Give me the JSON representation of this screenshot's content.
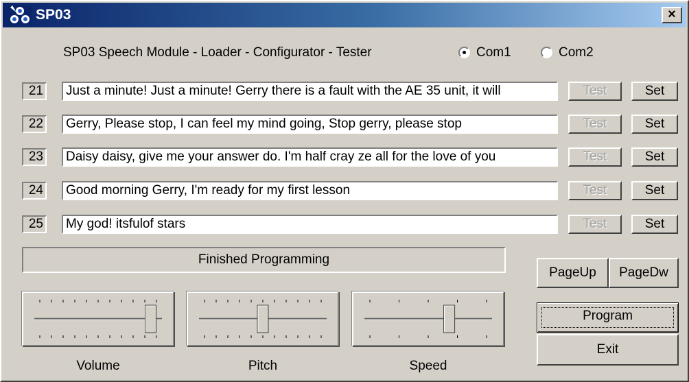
{
  "window": {
    "title": "SP03",
    "close_glyph": "×",
    "app_icon": "sp03-app-icon"
  },
  "header": {
    "subtitle": "SP03 Speech Module - Loader - Configurator - Tester",
    "ports": [
      {
        "label": "Com1",
        "selected": true
      },
      {
        "label": "Com2",
        "selected": false
      }
    ]
  },
  "phrases": [
    {
      "number": "21",
      "text": "Just a minute! Just a minute! Gerry there is a fault with the AE 35 unit, it will"
    },
    {
      "number": "22",
      "text": "Gerry, Please stop, I can feel my mind going, Stop gerry, please stop"
    },
    {
      "number": "23",
      "text": "Daisy daisy, give me your answer do. I'm half cray ze all for the love of you"
    },
    {
      "number": "24",
      "text": "Good morning Gerry, I'm ready for my first lesson"
    },
    {
      "number": "25",
      "text": "My god! itsfulof stars"
    }
  ],
  "row_buttons": {
    "test_label": "Test",
    "set_label": "Set",
    "test_enabled": false
  },
  "status": {
    "text": "Finished Programming"
  },
  "buttons": {
    "page_up": "PageUp",
    "page_down": "PageDw",
    "program": "Program",
    "exit": "Exit"
  },
  "sliders": [
    {
      "label": "Volume",
      "value_fraction": 0.95
    },
    {
      "label": "Pitch",
      "value_fraction": 0.5
    },
    {
      "label": "Speed",
      "value_fraction": 0.68
    }
  ]
}
